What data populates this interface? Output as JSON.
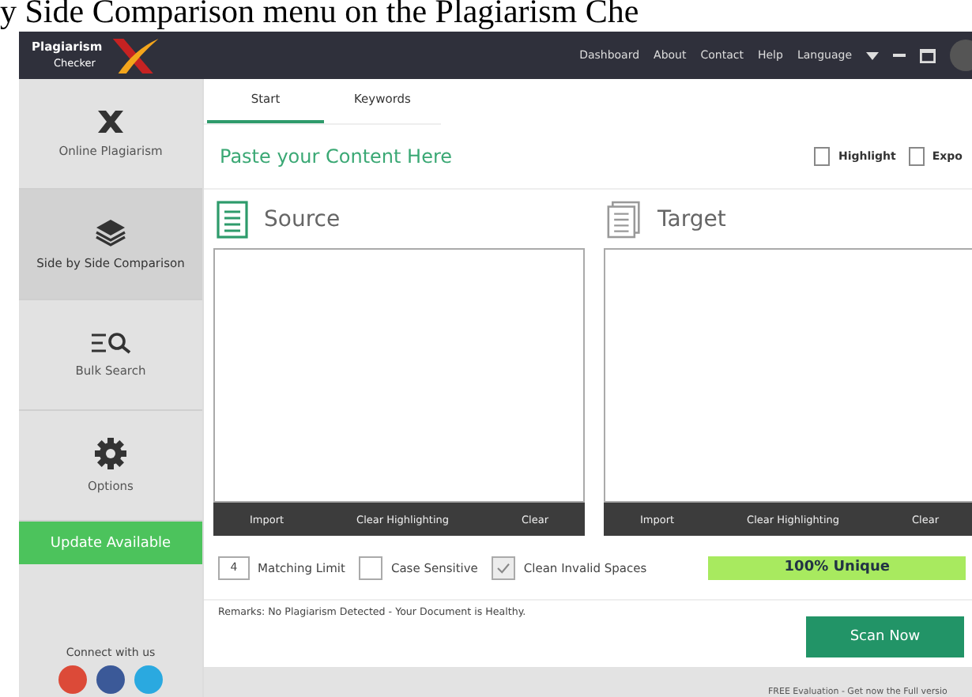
{
  "caption": "y Side Comparison menu on the Plagiarism Che",
  "window": {
    "logo_top": "Plagiarism",
    "logo_bottom": "Checker",
    "menu": [
      "Dashboard",
      "About",
      "Contact",
      "Help",
      "Language"
    ]
  },
  "sidebar": {
    "items": [
      {
        "kind": "x",
        "label": "Online Plagiarism",
        "selected": false
      },
      {
        "kind": "layers",
        "label": "Side by Side Comparison",
        "selected": true
      },
      {
        "kind": "bulk",
        "label": "Bulk Search",
        "selected": false
      },
      {
        "kind": "gear",
        "label": "Options",
        "selected": false
      }
    ],
    "update": "Update Available",
    "connect": "Connect with us"
  },
  "tabs": [
    {
      "label": "Start",
      "selected": true
    },
    {
      "label": "Keywords",
      "selected": false
    }
  ],
  "heading": "Paste your Content Here",
  "actions": [
    "Highlight",
    "Expo"
  ],
  "panels": [
    {
      "kind": "source",
      "title": "Source",
      "buttons": [
        "Import",
        "Clear Highlighting",
        "Clear"
      ]
    },
    {
      "kind": "target",
      "title": "Target",
      "buttons": [
        "Import",
        "Clear Highlighting",
        "Clear"
      ]
    }
  ],
  "matching_limit": "4",
  "matching_label": "Matching Limit",
  "options": [
    {
      "label": "Case Sensitive",
      "checked": false
    },
    {
      "label": "Clean Invalid Spaces",
      "checked": true
    }
  ],
  "result": "100% Unique",
  "remarks": "Remarks: No Plagiarism Detected - Your Document is Healthy.",
  "scan": "Scan Now",
  "footer": "FREE Evaluation - Get now the Full versio"
}
